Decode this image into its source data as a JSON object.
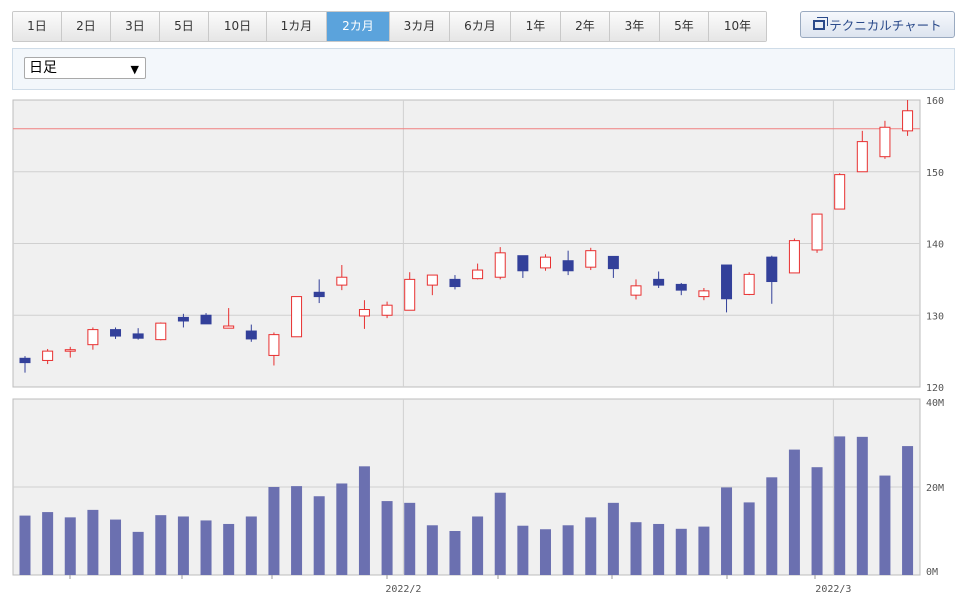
{
  "tabs": [
    "1日",
    "2日",
    "3日",
    "5日",
    "10日",
    "1カ月",
    "2カ月",
    "3カ月",
    "6カ月",
    "1年",
    "2年",
    "3年",
    "5年",
    "10年"
  ],
  "active_tab": "2カ月",
  "technical_button": "テクニカルチャート",
  "period_select": {
    "value": "日足"
  },
  "colors": {
    "up": "#e83030",
    "down": "#33409a",
    "volume": "#6b70b0",
    "hline": "#f08080",
    "plot_bg": "#f0f0f0",
    "grid": "#d0d0d0"
  },
  "chart_data": [
    {
      "type": "candlestick",
      "ylim": [
        120,
        160
      ],
      "yticks": [
        "120",
        "130",
        "140",
        "150",
        "160"
      ],
      "grid": true,
      "reference_line": 156,
      "x_labels": [
        {
          "label": "2022/2",
          "index": 17
        },
        {
          "label": "2022/3",
          "index": 36
        }
      ],
      "candles": [
        {
          "o": 124,
          "h": 124.3,
          "l": 122,
          "c": 123.4
        },
        {
          "o": 123.7,
          "h": 125.3,
          "l": 123.2,
          "c": 125
        },
        {
          "o": 125,
          "h": 125.6,
          "l": 124.1,
          "c": 125.2
        },
        {
          "o": 125.9,
          "h": 128.3,
          "l": 125.2,
          "c": 128
        },
        {
          "o": 128,
          "h": 128.3,
          "l": 126.7,
          "c": 127.1
        },
        {
          "o": 127.4,
          "h": 128.2,
          "l": 126.6,
          "c": 126.8
        },
        {
          "o": 126.6,
          "h": 129,
          "l": 126.5,
          "c": 128.9
        },
        {
          "o": 129.7,
          "h": 130.2,
          "l": 128.3,
          "c": 129.2
        },
        {
          "o": 130,
          "h": 130.3,
          "l": 128.8,
          "c": 128.8
        },
        {
          "o": 128.2,
          "h": 131,
          "l": 128.2,
          "c": 128.5
        },
        {
          "o": 127.8,
          "h": 128.7,
          "l": 126.3,
          "c": 126.7
        },
        {
          "o": 124.4,
          "h": 127.6,
          "l": 123,
          "c": 127.3
        },
        {
          "o": 127,
          "h": 132.6,
          "l": 127,
          "c": 132.6
        },
        {
          "o": 133.2,
          "h": 135,
          "l": 131.7,
          "c": 132.6
        },
        {
          "o": 134.2,
          "h": 137,
          "l": 133.5,
          "c": 135.3
        },
        {
          "o": 129.9,
          "h": 132.1,
          "l": 128.1,
          "c": 130.8
        },
        {
          "o": 130,
          "h": 131.9,
          "l": 129.6,
          "c": 131.4
        },
        {
          "o": 130.7,
          "h": 136,
          "l": 130.7,
          "c": 135
        },
        {
          "o": 134.2,
          "h": 135.5,
          "l": 132.8,
          "c": 135.6
        },
        {
          "o": 135,
          "h": 135.6,
          "l": 133.6,
          "c": 134
        },
        {
          "o": 135.1,
          "h": 137.2,
          "l": 135,
          "c": 136.3
        },
        {
          "o": 135.3,
          "h": 139.5,
          "l": 135,
          "c": 138.7
        },
        {
          "o": 138.3,
          "h": 138.3,
          "l": 135.2,
          "c": 136.2
        },
        {
          "o": 136.6,
          "h": 138.5,
          "l": 136.2,
          "c": 138.1
        },
        {
          "o": 137.6,
          "h": 139,
          "l": 135.6,
          "c": 136.2
        },
        {
          "o": 136.7,
          "h": 139.4,
          "l": 136.3,
          "c": 139
        },
        {
          "o": 138.2,
          "h": 138.2,
          "l": 135.2,
          "c": 136.5
        },
        {
          "o": 132.8,
          "h": 135,
          "l": 132.2,
          "c": 134.1
        },
        {
          "o": 135,
          "h": 136.1,
          "l": 133.8,
          "c": 134.2
        },
        {
          "o": 134.3,
          "h": 134.5,
          "l": 132.8,
          "c": 133.5
        },
        {
          "o": 132.6,
          "h": 133.8,
          "l": 132.1,
          "c": 133.4
        },
        {
          "o": 137,
          "h": 137,
          "l": 130.4,
          "c": 132.3
        },
        {
          "o": 132.9,
          "h": 136,
          "l": 132.8,
          "c": 135.7
        },
        {
          "o": 138.1,
          "h": 138.3,
          "l": 131.6,
          "c": 134.7
        },
        {
          "o": 135.9,
          "h": 140.7,
          "l": 135.9,
          "c": 140.4
        },
        {
          "o": 139.1,
          "h": 144.1,
          "l": 138.7,
          "c": 144.1
        },
        {
          "o": 144.8,
          "h": 149.8,
          "l": 144.8,
          "c": 149.6
        },
        {
          "o": 150,
          "h": 155.7,
          "l": 150,
          "c": 154.2
        },
        {
          "o": 152.1,
          "h": 157.1,
          "l": 151.8,
          "c": 156.2
        },
        {
          "o": 155.7,
          "h": 160,
          "l": 155,
          "c": 158.5
        }
      ]
    },
    {
      "type": "bar",
      "series_role": "volume",
      "ylim": [
        0,
        40
      ],
      "yticks": [
        "0M",
        "20M",
        "40M"
      ],
      "values": [
        13.5,
        14.3,
        13.1,
        14.8,
        12.6,
        9.8,
        13.6,
        13.3,
        12.4,
        11.6,
        13.3,
        20,
        20.2,
        17.9,
        20.8,
        24.7,
        16.8,
        16.4,
        11.3,
        10,
        13.3,
        18.7,
        11.2,
        10.4,
        11.3,
        13.1,
        16.4,
        12,
        11.6,
        10.5,
        11,
        19.9,
        16.5,
        22.2,
        28.5,
        24.5,
        31.5,
        31.4,
        22.6,
        29.3
      ]
    }
  ]
}
